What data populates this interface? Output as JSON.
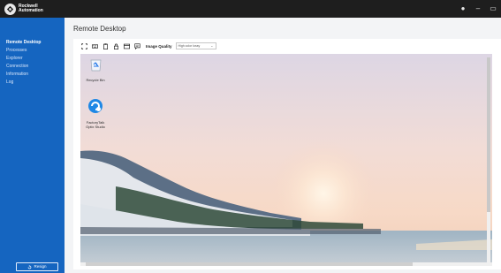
{
  "brand": {
    "line1": "Rockwell",
    "line2": "Automation"
  },
  "window_controls": [
    {
      "name": "account-icon",
      "glyph": "●"
    },
    {
      "name": "minimize-icon",
      "glyph": "–"
    },
    {
      "name": "maximize-icon",
      "glyph": "▭"
    }
  ],
  "sidebar": {
    "items": [
      {
        "label": "Remote Desktop",
        "active": true
      },
      {
        "label": "Processes",
        "active": false
      },
      {
        "label": "Explorer",
        "active": false
      },
      {
        "label": "Connection",
        "active": false
      },
      {
        "label": "Information",
        "active": false
      },
      {
        "label": "Log",
        "active": false
      }
    ],
    "resign_label": "Resign"
  },
  "main": {
    "title": "Remote Desktop",
    "toolbar": {
      "icons": [
        "fit-screen-icon",
        "keyboard-icon",
        "clipboard-icon",
        "lock-icon",
        "settings-window-icon",
        "chat-icon"
      ],
      "image_quality_label": "Image Quality",
      "image_quality_value": "High color lossy"
    }
  },
  "desktop": {
    "icons": [
      {
        "label": "Recycle Bin",
        "icon": "recycle-bin-icon"
      },
      {
        "label_line1": "FactoryTalk",
        "label_line2": "Optix Studio",
        "icon": "factorytalk-optix-icon"
      }
    ]
  },
  "colors": {
    "sidebar": "#1565c0",
    "titlebar": "#1e1e1e",
    "background": "#f3f4f6"
  }
}
